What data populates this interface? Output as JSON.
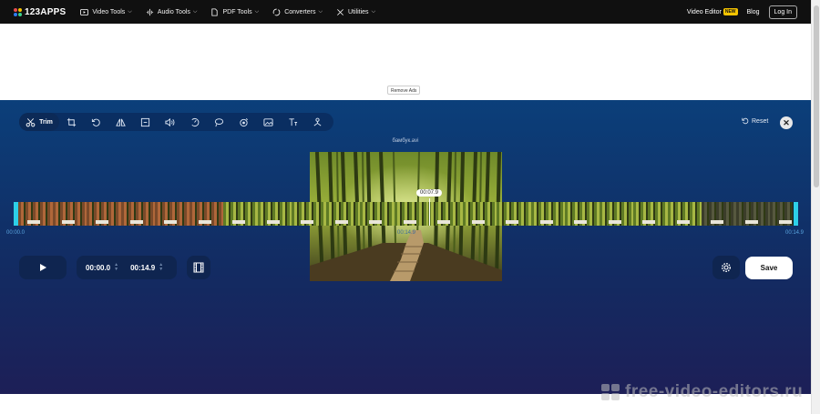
{
  "topnav": {
    "logo": "123APPS",
    "items": [
      {
        "label": "Video Tools",
        "icon": "play-circle-icon"
      },
      {
        "label": "Audio Tools",
        "icon": "waveform-icon"
      },
      {
        "label": "PDF Tools",
        "icon": "document-icon"
      },
      {
        "label": "Converters",
        "icon": "convert-icon"
      },
      {
        "label": "Utilities",
        "icon": "tools-icon"
      }
    ],
    "video_editor": "Video Editor",
    "new_badge": "NEW",
    "blog": "Blog",
    "login": "Log In"
  },
  "ads": {
    "remove_label": "Remove Ads"
  },
  "editor": {
    "toolbar": {
      "active_tool": "Trim",
      "tools": [
        "crop-icon",
        "rotate-icon",
        "flip-icon",
        "resize-icon",
        "volume-icon",
        "speed-icon",
        "loop-icon",
        "stabilize-icon",
        "image-icon",
        "text-icon",
        "filter-icon"
      ]
    },
    "reset_label": "Reset",
    "filename": "бамбук.avi",
    "timeline": {
      "playhead_time": "00:07.9",
      "playhead_fraction": 0.53,
      "start_label": "00:00.0",
      "mid_label": "00:14.9",
      "end_label": "00:14.9"
    },
    "controls": {
      "start_time": "00:00.0",
      "end_time": "00:14.9",
      "save_label": "Save"
    }
  },
  "watermark": "free-video-editors.ru"
}
